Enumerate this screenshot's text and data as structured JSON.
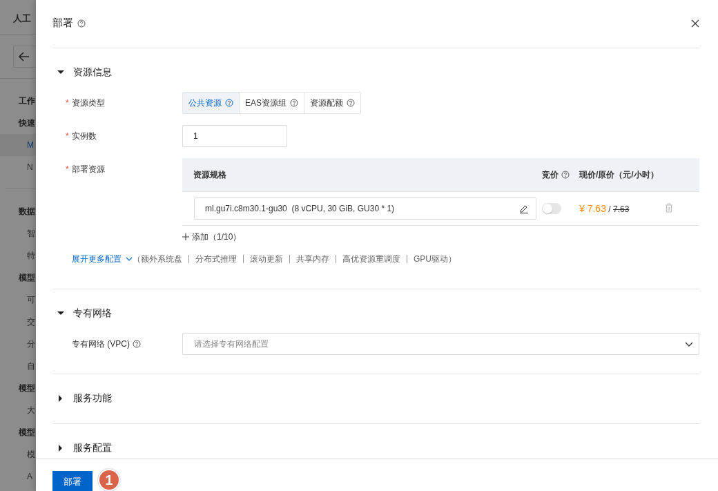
{
  "background_nav": {
    "title": "人工",
    "groups": [
      {
        "label": "工作"
      },
      {
        "label": "快速",
        "children": [
          {
            "label": "M",
            "selected": true
          },
          {
            "label": "N",
            "selected": false
          }
        ]
      },
      {
        "label": "数据",
        "children": [
          {
            "label": "智",
            "selected": false
          },
          {
            "label": "特",
            "selected": false
          }
        ]
      },
      {
        "label": "模型",
        "children": [
          {
            "label": "可",
            "selected": false
          },
          {
            "label": "交",
            "selected": false
          },
          {
            "label": "分",
            "selected": false
          },
          {
            "label": "自",
            "selected": false
          }
        ]
      },
      {
        "label": "模型",
        "children": [
          {
            "label": "大",
            "selected": false
          }
        ]
      },
      {
        "label": "模型",
        "children": [
          {
            "label": "模",
            "selected": false
          },
          {
            "label": "A",
            "selected": false
          }
        ]
      }
    ]
  },
  "drawer": {
    "title": "部署",
    "sections": [
      {
        "title": "资源信息",
        "expanded": true,
        "fields": [
          {
            "kind": "segmented",
            "label": "资源类型",
            "required_mark": "*",
            "options": [
              {
                "label": "公共资源",
                "selected": true
              },
              {
                "label": "EAS资源组",
                "selected": false
              },
              {
                "label": "资源配额",
                "selected": false
              }
            ]
          },
          {
            "kind": "input",
            "label": "实例数",
            "required_mark": "*",
            "value": "1"
          },
          {
            "kind": "table",
            "label": "部署资源",
            "required_mark": "*",
            "columns": [
              {
                "label": "资源规格",
                "help": false
              },
              {
                "label": "竞价",
                "help": true
              },
              {
                "label": "现价/原价（元/小时）",
                "help": false
              }
            ],
            "rows": [
              {
                "spec": "ml.gu7i.c8m30.1-gu30  (8 vCPU, 30 GiB, GU30 * 1)",
                "bidding": false,
                "price": "¥ 7.63",
                "separator": "/",
                "original_price": "7.63"
              }
            ],
            "add_button": "添加（1/10）"
          },
          {
            "kind": "more",
            "link": "展开更多配置",
            "prefix": "（",
            "options": [
              "额外系统盘",
              "分布式推理",
              "滚动更新",
              "共享内存",
              "高优资源重调度",
              "GPU驱动"
            ],
            "suffix": "）"
          }
        ]
      },
      {
        "title": "专有网络",
        "expanded": true,
        "fields": [
          {
            "kind": "select",
            "label": "专有网络 (VPC)",
            "help": true,
            "placeholder": "请选择专有网络配置"
          }
        ]
      },
      {
        "title": "服务功能",
        "expanded": false
      },
      {
        "title": "服务配置",
        "expanded": false
      }
    ],
    "footer": {
      "button": "部署",
      "step_badge": "1"
    }
  }
}
